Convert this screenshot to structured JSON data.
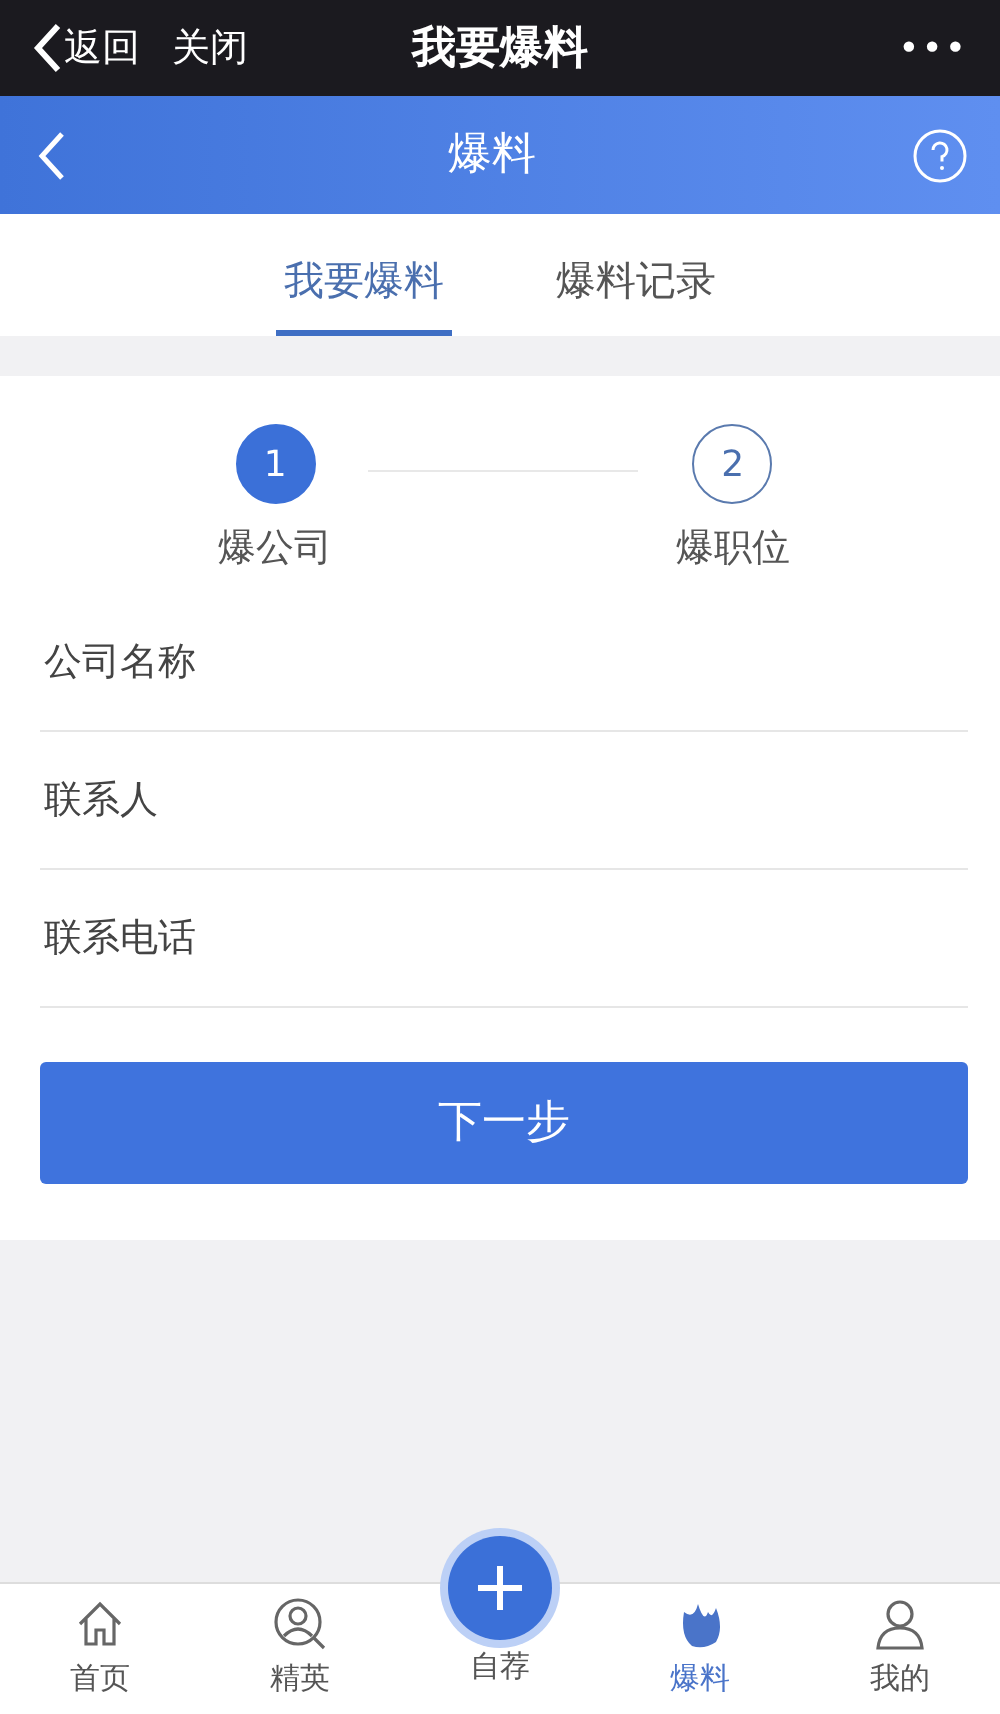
{
  "top_bar": {
    "back": "返回",
    "close": "关闭",
    "title": "我要爆料",
    "more": "•••"
  },
  "header": {
    "title": "爆料"
  },
  "tabs": [
    {
      "label": "我要爆料",
      "selected": true
    },
    {
      "label": "爆料记录",
      "selected": false
    }
  ],
  "steps": [
    {
      "number": "1",
      "label": "爆公司",
      "selected": true
    },
    {
      "number": "2",
      "label": "爆职位",
      "selected": false
    }
  ],
  "fields": [
    {
      "placeholder": "公司名称"
    },
    {
      "placeholder": "联系人"
    },
    {
      "placeholder": "联系电话"
    }
  ],
  "next_button": "下一步",
  "tab_bar": [
    {
      "kind": "home",
      "label": "首页",
      "selected": false
    },
    {
      "kind": "talent",
      "label": "精英",
      "selected": false
    },
    {
      "kind": "add",
      "label": "自荐",
      "selected": false
    },
    {
      "kind": "flame",
      "label": "爆料",
      "selected": true
    },
    {
      "kind": "profile",
      "label": "我的",
      "selected": false
    }
  ]
}
